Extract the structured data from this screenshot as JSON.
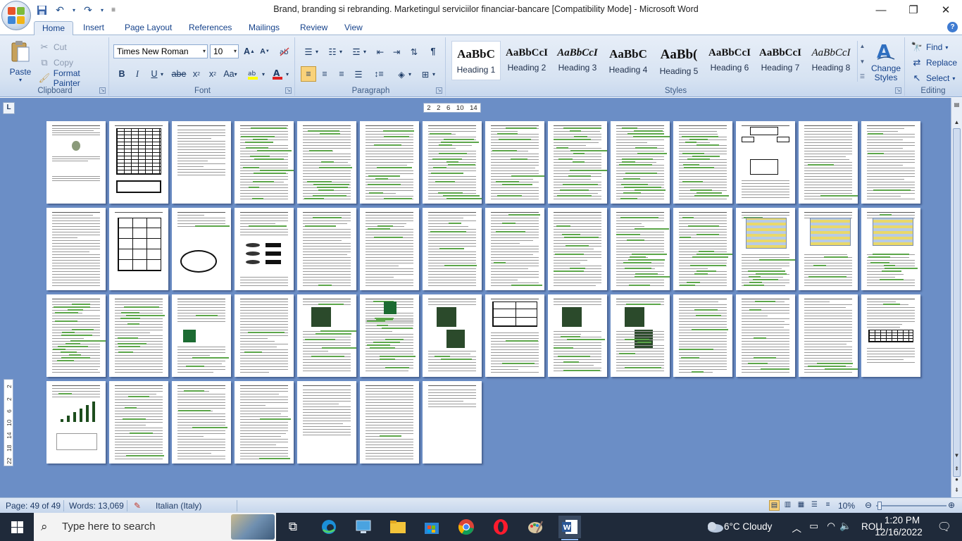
{
  "window": {
    "title": "Brand, branding si rebranding. Marketingul serviciilor financiar-bancare [Compatibility Mode] - Microsoft Word"
  },
  "qat": {
    "save_icon": "save-icon",
    "undo_icon": "undo-icon",
    "redo_icon": "redo-icon"
  },
  "tabs": [
    "Home",
    "Insert",
    "Page Layout",
    "References",
    "Mailings",
    "Review",
    "View"
  ],
  "clipboard": {
    "paste": "Paste",
    "cut": "Cut",
    "copy": "Copy",
    "format_painter": "Format Painter",
    "label": "Clipboard"
  },
  "font": {
    "name": "Times New Roman",
    "size": "10",
    "label": "Font"
  },
  "paragraph": {
    "label": "Paragraph"
  },
  "styles": {
    "label": "Styles",
    "change_styles": "Change Styles",
    "items": [
      {
        "preview": "AaBbC",
        "name": "Heading 1"
      },
      {
        "preview": "AaBbCcI",
        "name": "Heading 2"
      },
      {
        "preview": "AaBbCcI",
        "name": "Heading 3"
      },
      {
        "preview": "AaBbC",
        "name": "Heading 4"
      },
      {
        "preview": "AaBb(",
        "name": "Heading 5"
      },
      {
        "preview": "AaBbCcI",
        "name": "Heading 6"
      },
      {
        "preview": "AaBbCcI",
        "name": "Heading 7"
      },
      {
        "preview": "AaBbCcI",
        "name": "Heading 8"
      }
    ]
  },
  "editing": {
    "find": "Find",
    "replace": "Replace",
    "select": "Select",
    "label": "Editing"
  },
  "ruler": {
    "tab_stop": "L",
    "horizontal_ticks": [
      "2",
      "2",
      "6",
      "10",
      "14"
    ],
    "vertical_ticks": [
      "2",
      "2",
      "6",
      "10",
      "14",
      "18",
      "22"
    ]
  },
  "status": {
    "page": "Page: 49 of 49",
    "words": "Words: 13,069",
    "language": "Italian (Italy)",
    "zoom": "10%"
  },
  "taskbar": {
    "search_placeholder": "Type here to search",
    "weather": "6°C  Cloudy",
    "language": "ROU",
    "time": "1:20 PM",
    "date": "12/16/2022"
  }
}
